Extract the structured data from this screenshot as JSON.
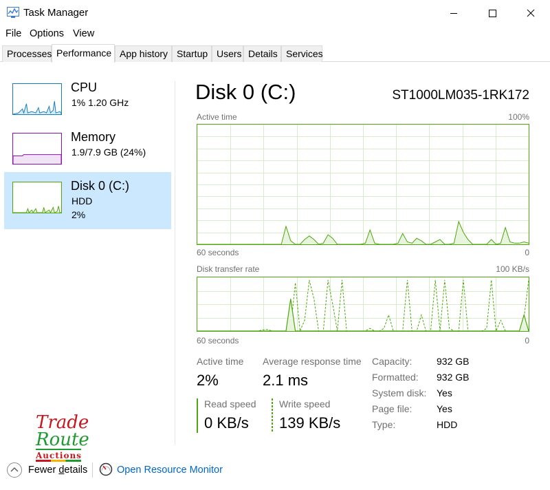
{
  "window": {
    "title": "Task Manager",
    "minimize_icon": "minimize-icon",
    "maximize_icon": "maximize-icon",
    "close_icon": "close-icon"
  },
  "menu": {
    "file": "File",
    "options": "Options",
    "view": "View"
  },
  "tabs": [
    "Processes",
    "Performance",
    "App history",
    "Startup",
    "Users",
    "Details",
    "Services"
  ],
  "active_tab": "Performance",
  "sidebar": {
    "items": [
      {
        "name": "CPU",
        "sub1": "1%  1.20 GHz",
        "sub2": "",
        "color": "#117dbb"
      },
      {
        "name": "Memory",
        "sub1": "1.9/7.9 GB (24%)",
        "sub2": "",
        "color": "#8b12ae"
      },
      {
        "name": "Disk 0 (C:)",
        "sub1": "HDD",
        "sub2": "2%",
        "color": "#4da60c"
      }
    ]
  },
  "disk": {
    "title": "Disk 0 (C:)",
    "model": "ST1000LM035-1RK172",
    "active_graph": {
      "label": "Active time",
      "max_label": "100%",
      "time_label": "60 seconds",
      "min_label": "0",
      "values": [
        0,
        0,
        0,
        0,
        0,
        0,
        0,
        0,
        0,
        0,
        0,
        0,
        0,
        0,
        0,
        0,
        0,
        0,
        0,
        15,
        3,
        0,
        0,
        4,
        7,
        4,
        0,
        1,
        8,
        5,
        0,
        0,
        0,
        0,
        0,
        0,
        1,
        12,
        1,
        0,
        0,
        0,
        0,
        1,
        9,
        2,
        1,
        5,
        3,
        0,
        0,
        2,
        4,
        0,
        0,
        1,
        19,
        10,
        4,
        0,
        0,
        0,
        0,
        4,
        0,
        1,
        14,
        2,
        1,
        1,
        2,
        1
      ]
    },
    "transfer_graph": {
      "label": "Disk transfer rate",
      "max_label": "100 KB/s",
      "time_label": "60 seconds",
      "min_label": "0",
      "read_values": [
        0,
        0,
        0,
        0,
        0,
        0,
        0,
        0,
        0,
        0,
        0,
        0,
        0,
        0,
        0,
        0,
        0,
        0,
        0,
        0,
        60,
        0,
        0,
        0,
        0,
        0,
        0,
        0,
        0,
        0,
        0,
        0,
        0,
        0,
        0,
        0,
        0,
        0,
        0,
        0,
        0,
        0,
        0,
        0,
        0,
        0,
        0,
        0,
        0,
        0,
        0,
        0,
        0,
        0,
        0,
        0,
        0,
        0,
        0,
        0,
        0,
        0,
        0,
        0,
        0,
        0,
        0,
        0,
        0,
        0,
        30,
        0
      ],
      "write_values": [
        0,
        0,
        0,
        0,
        0,
        0,
        0,
        0,
        0,
        0,
        0,
        0,
        0,
        0,
        2,
        3,
        0,
        0,
        0,
        0,
        5,
        90,
        0,
        20,
        95,
        60,
        0,
        0,
        95,
        50,
        0,
        95,
        0,
        0,
        0,
        0,
        0,
        5,
        0,
        0,
        5,
        30,
        0,
        0,
        0,
        95,
        0,
        0,
        30,
        0,
        0,
        95,
        0,
        95,
        5,
        0,
        0,
        95,
        0,
        0,
        0,
        0,
        5,
        95,
        0,
        20,
        0,
        0,
        0,
        0,
        25,
        95
      ]
    },
    "stats": {
      "active_time_label": "Active time",
      "active_time_value": "2%",
      "avg_response_label": "Average response time",
      "avg_response_value": "2.1 ms",
      "read_speed_label": "Read speed",
      "read_speed_value": "0 KB/s",
      "write_speed_label": "Write speed",
      "write_speed_value": "139 KB/s"
    },
    "properties": [
      {
        "label": "Capacity:",
        "value": "932 GB"
      },
      {
        "label": "Formatted:",
        "value": "932 GB"
      },
      {
        "label": "System disk:",
        "value": "Yes"
      },
      {
        "label": "Page file:",
        "value": "Yes"
      },
      {
        "label": "Type:",
        "value": "HDD"
      }
    ]
  },
  "logo": {
    "line1": "Trade",
    "line2": "Route",
    "line3": "Auctions"
  },
  "footer": {
    "fewer_details_prefix": "Fewer ",
    "fewer_details_underlined": "d",
    "fewer_details_suffix": "etails",
    "resource_monitor": "Open Resource Monitor"
  },
  "colors": {
    "disk_accent": "#4da60c",
    "disk_fill": "#e8f4dd",
    "selected_bg": "#cce8ff",
    "link": "#0066cc"
  }
}
